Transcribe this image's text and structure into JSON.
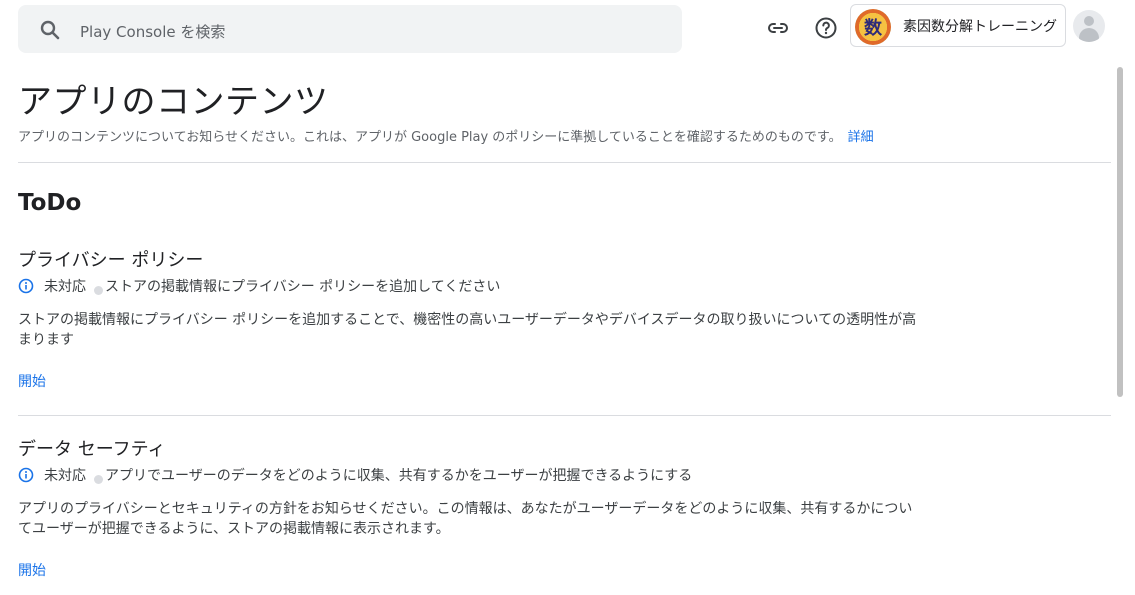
{
  "search": {
    "placeholder": "Play Console を検索"
  },
  "app": {
    "icon_glyph": "数",
    "name": "素因数分解トレーニング"
  },
  "header": {
    "title": "アプリのコンテンツ",
    "description": "アプリのコンテンツについてお知らせください。これは、アプリが Google Play のポリシーに準拠していることを確認するためのものです。",
    "details_link": "詳細"
  },
  "todo": {
    "title": "ToDo",
    "tasks": [
      {
        "title": "プライバシー ポリシー",
        "status": "未対応",
        "status_detail": "ストアの掲載情報にプライバシー ポリシーを追加してください",
        "description": "ストアの掲載情報にプライバシー ポリシーを追加することで、機密性の高いユーザーデータやデバイスデータの取り扱いについての透明性が高まります",
        "action": "開始"
      },
      {
        "title": "データ セーフティ",
        "status": "未対応",
        "status_detail": "アプリでユーザーのデータをどのように収集、共有するかをユーザーが把握できるようにする",
        "description": "アプリのプライバシーとセキュリティの方針をお知らせください。この情報は、あなたがユーザーデータをどのように収集、共有するかについてユーザーが把握できるように、ストアの掲載情報に表示されます。",
        "action": "開始"
      }
    ]
  },
  "icons": {
    "search": "search-icon",
    "link": "link-icon",
    "help": "help-icon",
    "info": "info-icon",
    "avatar": "account-icon"
  },
  "colors": {
    "accent": "#1a73e8",
    "text": "#202124",
    "muted": "#5f6368",
    "search_bg": "#f1f3f4"
  }
}
